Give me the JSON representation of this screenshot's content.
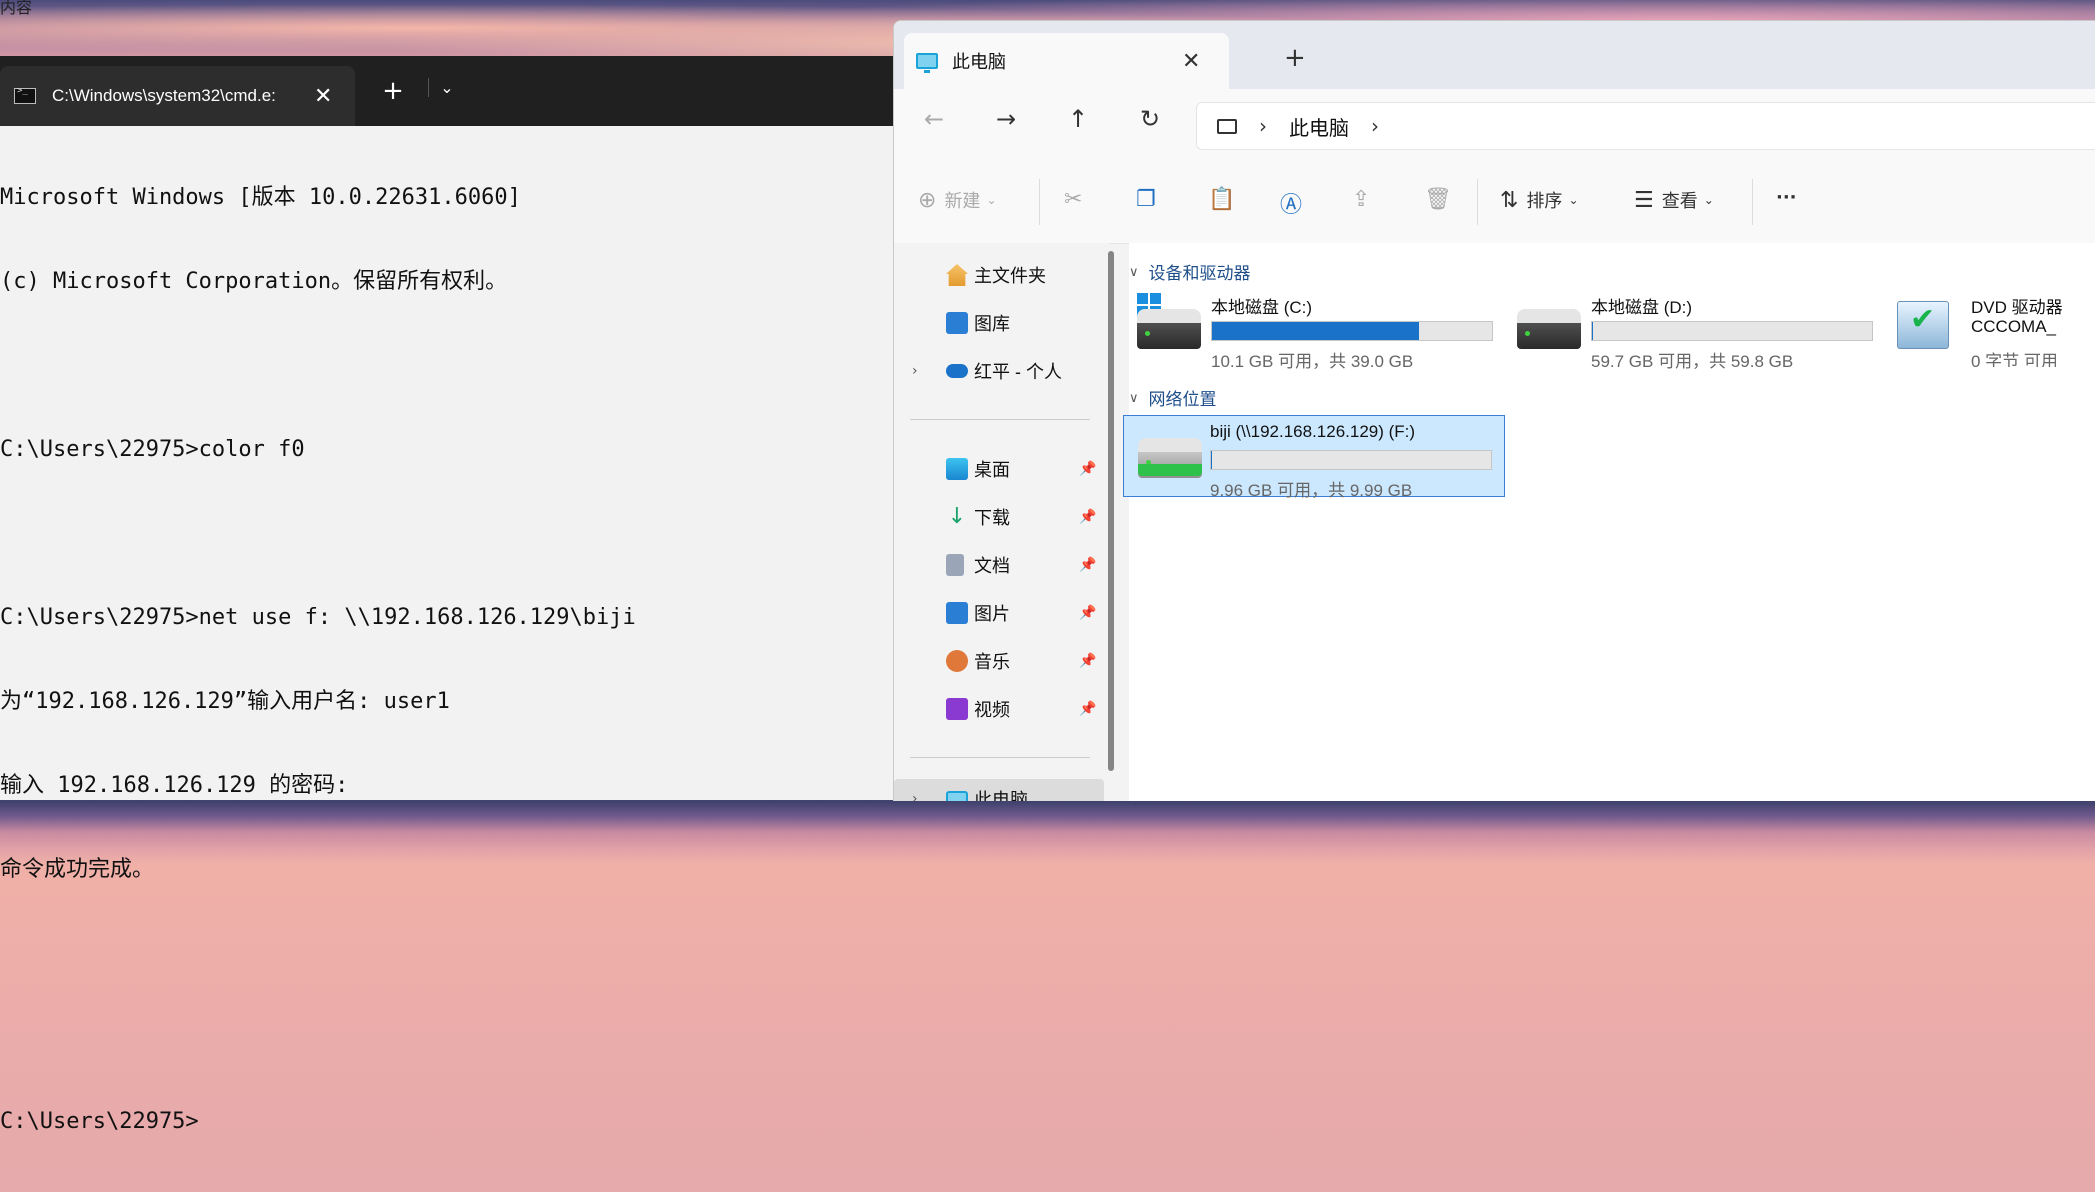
{
  "wallpaper": {
    "corner_text": "内容"
  },
  "terminal": {
    "tab_title": "C:\\Windows\\system32\\cmd.e:",
    "new_tab": "+",
    "dropdown": "⌄",
    "close": "✕",
    "lines": [
      "Microsoft Windows [版本 10.0.22631.6060]",
      "(c) Microsoft Corporation。保留所有权利。",
      "",
      "C:\\Users\\22975>color f0",
      "",
      "C:\\Users\\22975>net use f: \\\\192.168.126.129\\biji",
      "为“192.168.126.129”输入用户名: user1",
      "输入 192.168.126.129 的密码:",
      "命令成功完成。",
      "",
      "",
      "C:\\Users\\22975>"
    ]
  },
  "explorer": {
    "tab_title": "此电脑",
    "tab_close": "✕",
    "new_tab": "+",
    "nav": {
      "back": "←",
      "forward": "→",
      "up": "↑",
      "refresh": "↻"
    },
    "address": {
      "crumb": "此电脑",
      "sep1": "›",
      "sep2": "›"
    },
    "toolbar": {
      "new_label": "新建",
      "sort_label": "排序",
      "view_label": "查看",
      "more": "···"
    },
    "sidebar": {
      "items": [
        {
          "label": "主文件夹"
        },
        {
          "label": "图库"
        },
        {
          "label": "红平 - 个人"
        },
        {
          "label": "桌面"
        },
        {
          "label": "下载"
        },
        {
          "label": "文档"
        },
        {
          "label": "图片"
        },
        {
          "label": "音乐"
        },
        {
          "label": "视频"
        },
        {
          "label": "此电脑"
        }
      ]
    },
    "sections": {
      "devices": "设备和驱动器",
      "network": "网络位置"
    },
    "drives": [
      {
        "name": "本地磁盘 (C:)",
        "info": "10.1 GB 可用，共 39.0 GB",
        "used_fraction": 0.74
      },
      {
        "name": "本地磁盘 (D:)",
        "info": "59.7 GB 可用，共 59.8 GB",
        "used_fraction": 0.002
      },
      {
        "name": "DVD 驱动器",
        "name2": "CCCOMA_",
        "info": "0 字节 可用"
      }
    ],
    "network_drives": [
      {
        "name": "biji (\\\\192.168.126.129) (F:)",
        "info": "9.96 GB 可用，共 9.99 GB",
        "used_fraction": 0.003
      }
    ],
    "colors": {
      "accent": "#1a73c9",
      "selected_bg": "#cce8ff"
    }
  }
}
